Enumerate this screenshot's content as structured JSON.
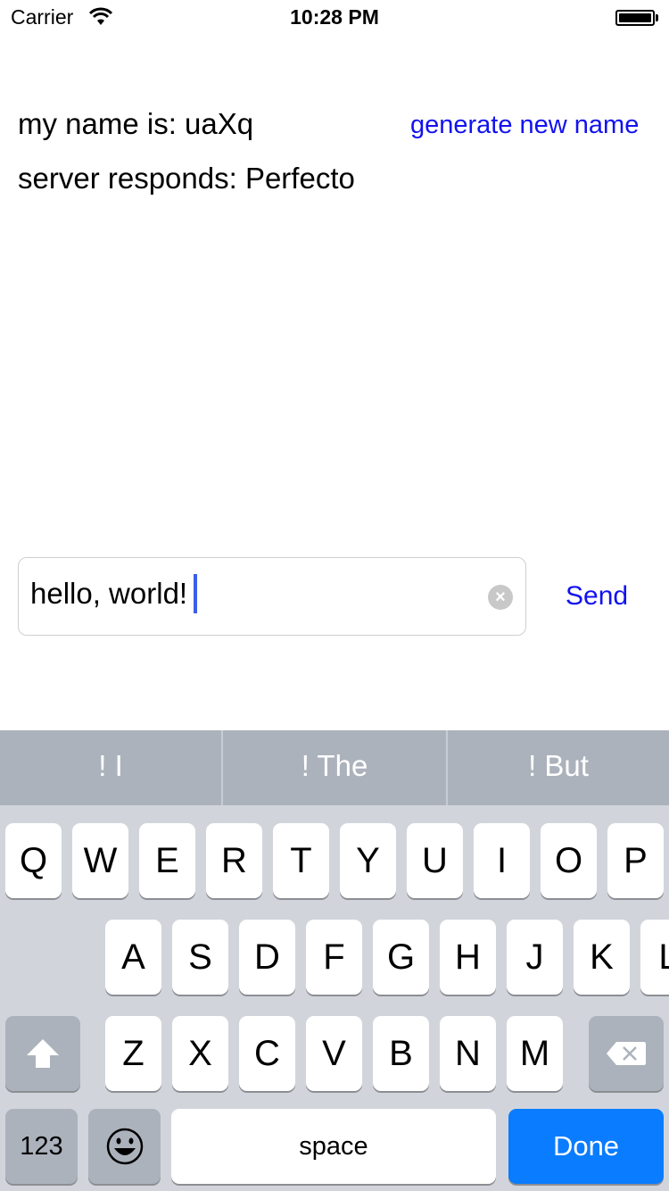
{
  "status_bar": {
    "carrier": "Carrier",
    "wifi_icon": "wifi-icon",
    "time": "10:28 PM",
    "battery_icon": "battery-full-icon",
    "battery_level_percent": 100
  },
  "main": {
    "name_label": "my name is: uaXq",
    "generate_button": "generate new name",
    "server_label": "server responds: Perfecto",
    "message_input_value": "hello, world!",
    "clear_icon": "clear-circle-icon",
    "send_button": "Send",
    "link_color": "#1212f0"
  },
  "keyboard": {
    "suggestions": [
      "! I",
      "! The",
      "! But"
    ],
    "row1": [
      "Q",
      "W",
      "E",
      "R",
      "T",
      "Y",
      "U",
      "I",
      "O",
      "P"
    ],
    "row2": [
      "A",
      "S",
      "D",
      "F",
      "G",
      "H",
      "J",
      "K",
      "L"
    ],
    "row3": [
      "Z",
      "X",
      "C",
      "V",
      "B",
      "N",
      "M"
    ],
    "numbers_key": "123",
    "space_key": "space",
    "done_key": "Done",
    "shift_icon": "shift-icon",
    "delete_icon": "backspace-icon",
    "emoji_icon": "emoji-icon",
    "done_color": "#0a7cff"
  }
}
